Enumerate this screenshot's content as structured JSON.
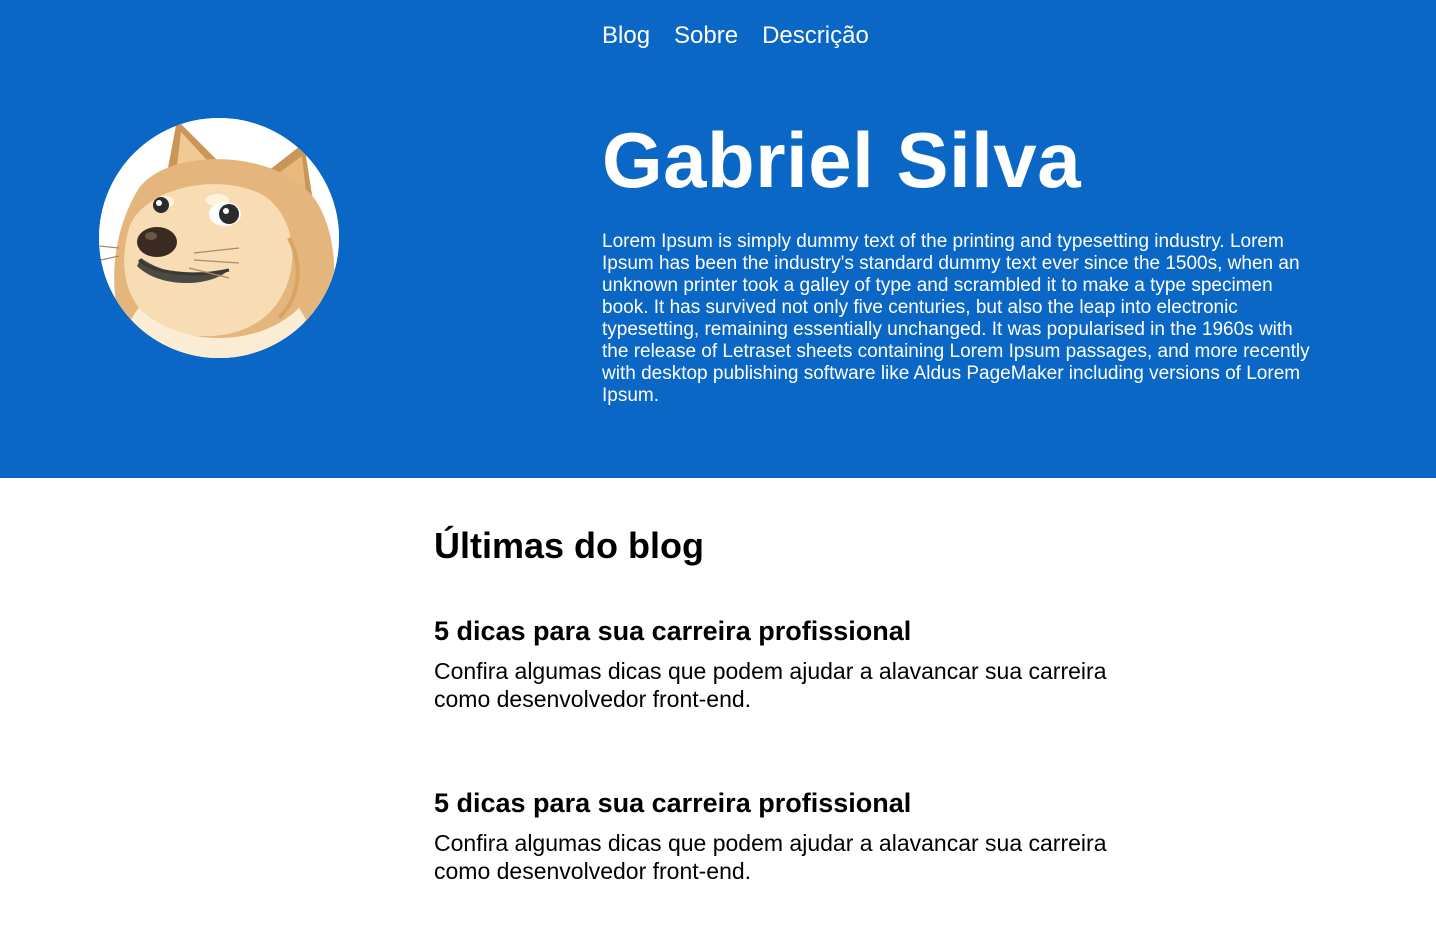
{
  "nav": {
    "items": [
      {
        "label": "Blog"
      },
      {
        "label": "Sobre"
      },
      {
        "label": "Descrição"
      }
    ]
  },
  "profile": {
    "name": "Gabriel Silva",
    "bio": "Lorem Ipsum is simply dummy text of the printing and typesetting industry. Lorem Ipsum has been the industry's standard dummy text ever since the 1500s, when an unknown printer took a galley of type and scrambled it to make a type specimen book. It has survived not only five centuries, but also the leap into electronic typesetting, remaining essentially unchanged. It was popularised in the 1960s with the release of Letraset sheets containing Lorem Ipsum passages, and more recently with desktop publishing software like Aldus PageMaker including versions of Lorem Ipsum.",
    "avatar_icon": "doge-avatar"
  },
  "blog": {
    "title": "Últimas do blog",
    "posts": [
      {
        "title": "5 dicas para sua carreira profissional",
        "summary": "Confira algumas dicas que podem ajudar a alavancar sua carreira como desenvolvedor front-end."
      },
      {
        "title": "5 dicas para sua carreira profissional",
        "summary": "Confira algumas dicas que podem ajudar a alavancar sua carreira como desenvolvedor front-end."
      }
    ]
  },
  "colors": {
    "hero_background": "#0b67c5",
    "hero_text": "#ffffff",
    "body_text": "#000000"
  }
}
